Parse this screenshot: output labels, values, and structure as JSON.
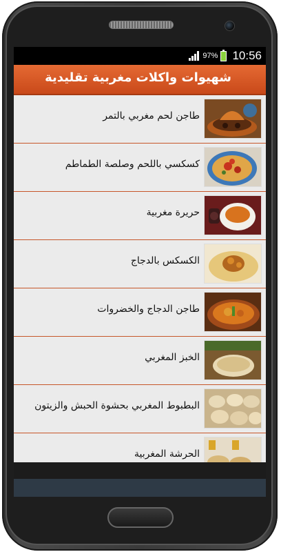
{
  "status": {
    "battery_pct": "97%",
    "time": "10:56",
    "battery_level": 0.97
  },
  "app": {
    "title": "شهيوات واكلات مغربية تقليدية"
  },
  "recipes": [
    {
      "label": "طاجن لحم مغربي بالتمر",
      "image": "tagine-dates-photo"
    },
    {
      "label": "كسكسي باللحم وصلصة الطماطم",
      "image": "couscous-tomato-photo"
    },
    {
      "label": "حريرة مغربية",
      "image": "harira-soup-photo"
    },
    {
      "label": "الكسكس بالدجاج",
      "image": "chicken-couscous-photo"
    },
    {
      "label": "طاجن الدجاج والخضروات",
      "image": "chicken-vegetable-tagine-photo"
    },
    {
      "label": "الخبز المغربي",
      "image": "moroccan-bread-photo"
    },
    {
      "label": "البطبوط المغربي بحشوة الحبش والزيتون",
      "image": "batbout-photo"
    },
    {
      "label": "الحرشة المغربية",
      "image": "harcha-photo"
    }
  ],
  "colors": {
    "appbar": "#d9582a",
    "divider": "#c65528",
    "list_bg": "#ebebeb"
  }
}
